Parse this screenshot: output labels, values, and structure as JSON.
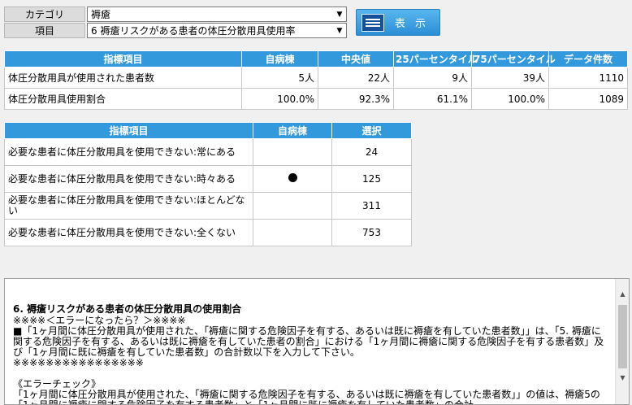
{
  "selectors": {
    "category": {
      "label": "カテゴリ",
      "value": "褥瘡"
    },
    "item": {
      "label": "項目",
      "value": "6  褥瘡リスクがある患者の体圧分散用具使用率"
    }
  },
  "show_button": {
    "label": "表 示",
    "icon": "list-icon"
  },
  "table1": {
    "headers": [
      "指標項目",
      "自病棟",
      "中央値",
      "25パーセンタイル",
      "75パーセンタイル",
      "データ件数"
    ],
    "rows": [
      [
        "体圧分散用具が使用された患者数",
        "5人",
        "22人",
        "9人",
        "39人",
        "1110"
      ],
      [
        "体圧分散用具使用割合",
        "100.0%",
        "92.3%",
        "61.1%",
        "100.0%",
        "1089"
      ]
    ]
  },
  "table2": {
    "headers": [
      "指標項目",
      "自病棟",
      "選択"
    ],
    "rows": [
      {
        "label": "必要な患者に体圧分散用具を使用できない:常にある",
        "own_ward_marked": false,
        "count": "24"
      },
      {
        "label": "必要な患者に体圧分散用具を使用できない:時々ある",
        "own_ward_marked": true,
        "count": "125"
      },
      {
        "label": "必要な患者に体圧分散用具を使用できない:ほとんどない",
        "own_ward_marked": false,
        "count": "311"
      },
      {
        "label": "必要な患者に体圧分散用具を使用できない:全くない",
        "own_ward_marked": false,
        "count": "753"
      }
    ]
  },
  "description": {
    "title": "6. 褥瘡リスクがある患者の体圧分散用具の使用割合",
    "body": "※※※※＜エラーになったら？＞※※※※\n■「1ヶ月間に体圧分散用具が使用された、「褥瘡に関する危険因子を有する、あるいは既に褥瘡を有していた患者数」」は、「5. 褥瘡に関する危険因子を有する、あるいは既に褥瘡を有していた患者の割合」における「1ヶ月間に褥瘡に関する危険因子を有する患者数」及び「1ヶ月間に既に褥瘡を有していた患者数」の合計数以下を入力して下さい。\n※※※※※※※※※※※※※※※※\n\n《エラーチェック》\n「1ヶ月間に体圧分散用具が使用された、「褥瘡に関する危険因子を有する、あるいは既に褥瘡を有していた患者数」」の値は、褥瘡5の「1ヶ月間に褥瘡に関する危険因子を有する患者数」と「1ヶ月間に既に褥瘡を有していた患者数」の合計"
  }
}
